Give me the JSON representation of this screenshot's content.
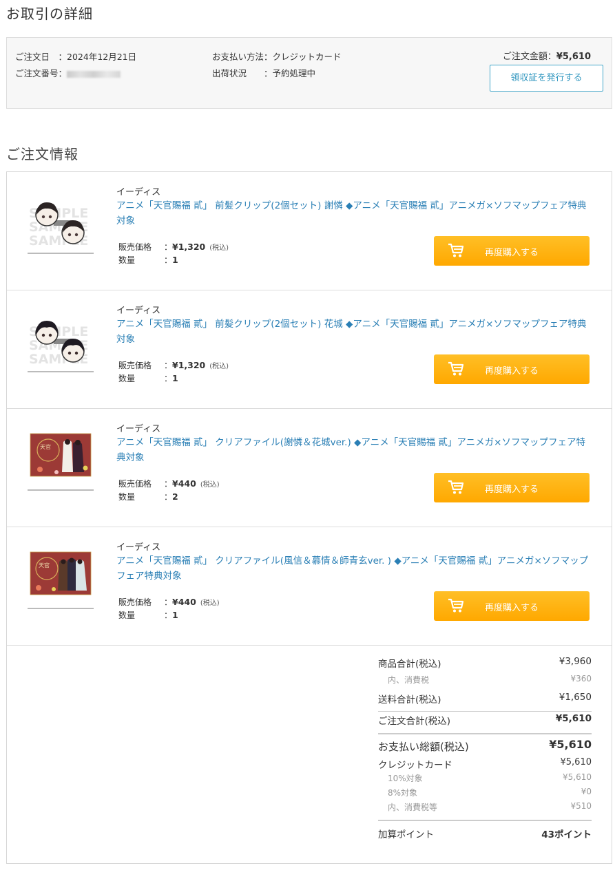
{
  "page_title": "お取引の詳細",
  "summary": {
    "order_date_label": "ご注文日　：",
    "order_date": "2024年12月21日",
    "order_no_label": "ご注文番号：",
    "payment_label": "お支払い方法：",
    "payment": "クレジットカード",
    "shipping_label": "出荷状況　　：",
    "shipping": "予約処理中",
    "total_label": "ご注文金額：",
    "total": "¥5,610",
    "receipt_button": "領収証を発行する"
  },
  "section_title": "ご注文情報",
  "labels": {
    "price": "販売価格",
    "qty": "数量",
    "tax_in": "(税込)",
    "colon": "：",
    "rebuy": "再度購入する"
  },
  "items": [
    {
      "maker": "イーディス",
      "title": "アニメ「天官賜福 貳」 前髪クリップ(2個セット) 謝憐 ◆アニメ「天官賜福 貳」アニメガ×ソフマップフェア特典対象",
      "price": "¥1,320",
      "qty": "1",
      "thumb": "sample-hairclip-xielian"
    },
    {
      "maker": "イーディス",
      "title": "アニメ「天官賜福 貳」 前髪クリップ(2個セット) 花城 ◆アニメ「天官賜福 貳」アニメガ×ソフマップフェア特典対象",
      "price": "¥1,320",
      "qty": "1",
      "thumb": "sample-hairclip-huacheng"
    },
    {
      "maker": "イーディス",
      "title": "アニメ「天官賜福 貳」 クリアファイル(謝憐＆花城ver.) ◆アニメ「天官賜福 貳」アニメガ×ソフマップフェア特典対象",
      "price": "¥440",
      "qty": "2",
      "thumb": "clearfile-red"
    },
    {
      "maker": "イーディス",
      "title": "アニメ「天官賜福 貳」 クリアファイル(風信＆慕情＆師青玄ver. ) ◆アニメ「天官賜福 貳」アニメガ×ソフマップフェア特典対象",
      "price": "¥440",
      "qty": "1",
      "thumb": "clearfile-red"
    }
  ],
  "totals": {
    "goods_label": "商品合計(税込)",
    "goods": "¥3,960",
    "goods_tax_label": "内、消費税",
    "goods_tax": "¥360",
    "shipping_label": "送料合計(税込)",
    "shipping": "¥1,650",
    "order_total_label": "ご注文合計(税込)",
    "order_total": "¥5,610",
    "pay_total_label": "お支払い総額(税込)",
    "pay_total": "¥5,610",
    "credit_label": "クレジットカード",
    "credit": "¥5,610",
    "rate10_label": "10%対象",
    "rate10": "¥5,610",
    "rate8_label": "8%対象",
    "rate8": "¥0",
    "tax_label": "内、消費税等",
    "tax": "¥510",
    "points_label": "加算ポイント",
    "points": "43ポイント"
  },
  "colors": {
    "link": "#2a7fb5",
    "button_orange": "#ffa800",
    "receipt_border": "#41a6c9"
  }
}
